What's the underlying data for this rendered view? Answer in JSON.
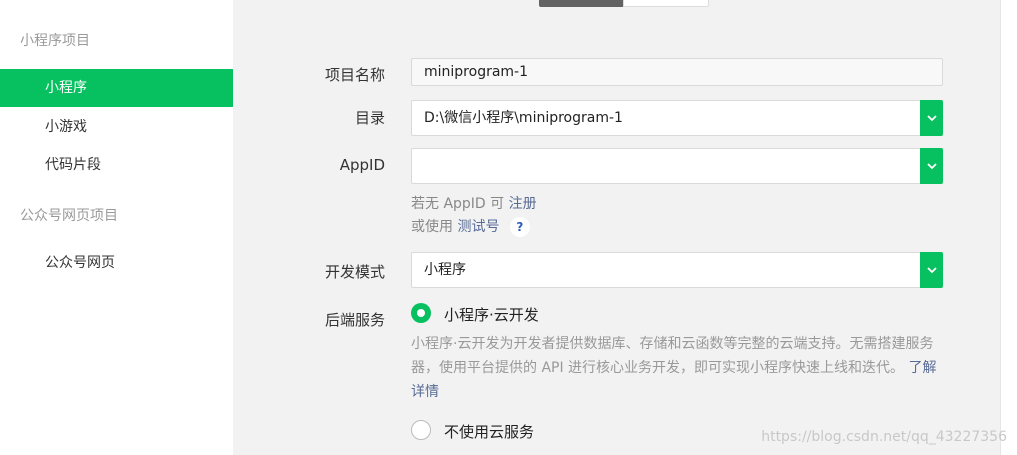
{
  "sidebar": {
    "section1": "小程序项目",
    "items1": [
      "小程序",
      "小游戏",
      "代码片段"
    ],
    "section2": "公众号网页项目",
    "items2": [
      "公众号网页"
    ]
  },
  "form": {
    "name_label": "项目名称",
    "name_value": "miniprogram-1",
    "dir_label": "目录",
    "dir_value": "D:\\微信小程序\\miniprogram-1",
    "appid_label": "AppID",
    "appid_value": "",
    "hint_no_appid": "若无 AppID 可",
    "register_link": "注册",
    "hint_use": "或使用",
    "test_link": "测试号",
    "help_mark": "?",
    "mode_label": "开发模式",
    "mode_value": "小程序",
    "backend_label": "后端服务",
    "option_cloud": "小程序·云开发",
    "cloud_desc": "小程序·云开发为开发者提供数据库、存储和云函数等完整的云端支持。无需搭建服务器，使用平台提供的 API 进行核心业务开发，即可实现小程序快速上线和迭代。",
    "learn_more": "了解详情",
    "option_none": "不使用云服务"
  },
  "watermark": "https://blog.csdn.net/qq_43227356",
  "colors": {
    "accent": "#07c160",
    "link": "#576b95"
  }
}
